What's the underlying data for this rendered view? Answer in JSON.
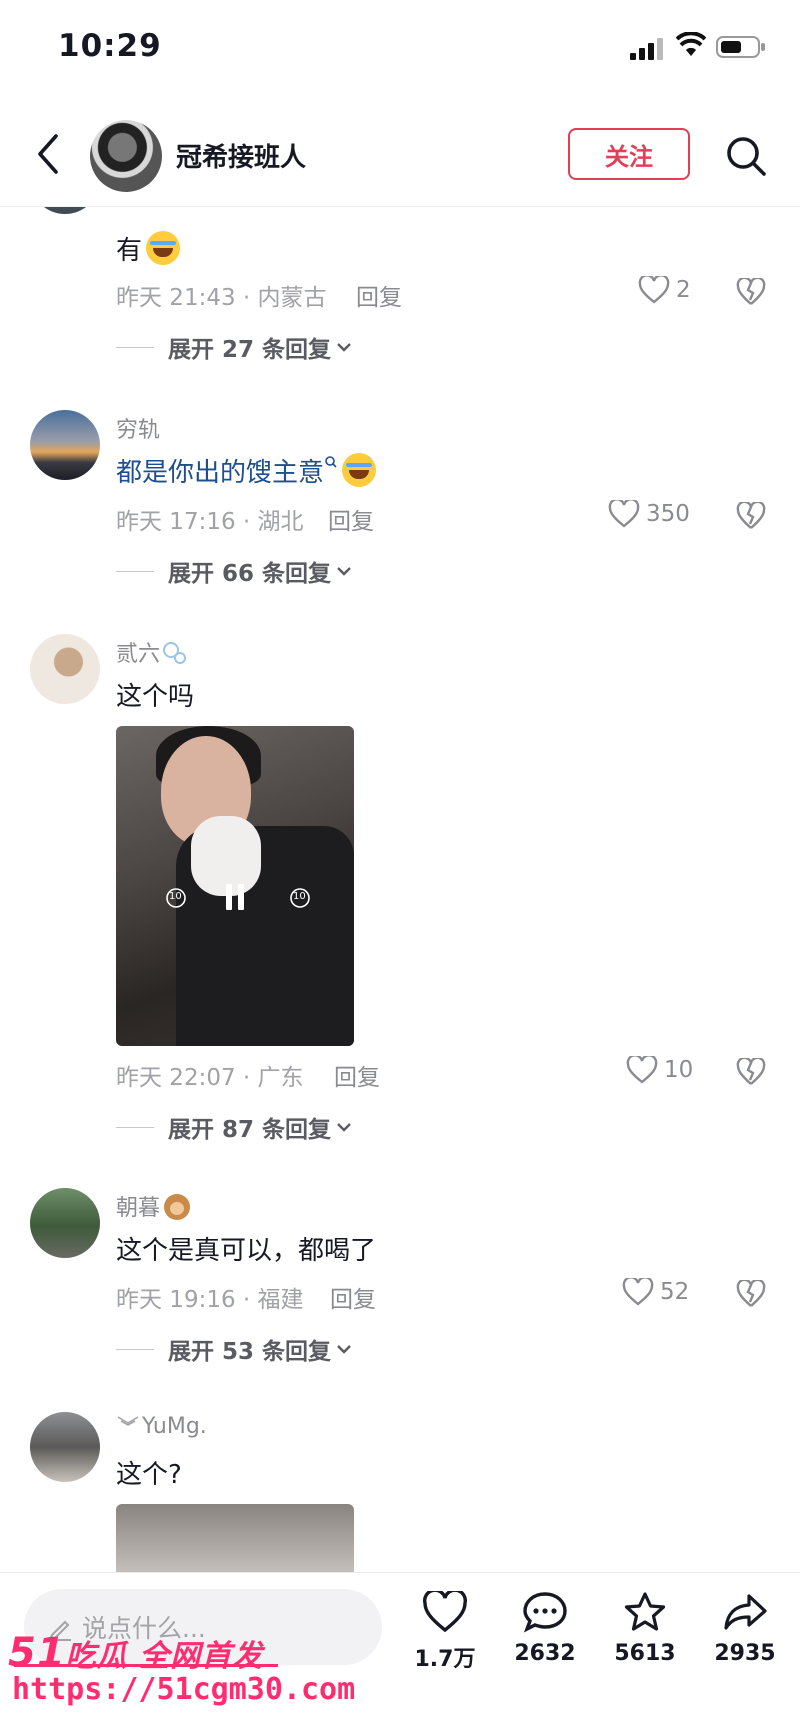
{
  "status_bar": {
    "time": "10:29"
  },
  "header": {
    "title": "冠希接班人",
    "follow_label": "关注"
  },
  "comments": [
    {
      "username": "",
      "text": "有",
      "meta": "昨天 21:43 · 内蒙古",
      "reply_label": "回复",
      "likes": "2",
      "expand": "展开 27 条回复"
    },
    {
      "username": "穷轨",
      "text": "都是你出的馊主意",
      "meta": "昨天 17:16 · 湖北",
      "reply_label": "回复",
      "likes": "350",
      "expand": "展开 66 条回复"
    },
    {
      "username": "贰六",
      "text": "这个吗",
      "meta": "昨天 22:07 · 广东",
      "reply_label": "回复",
      "likes": "10",
      "expand": "展开 87 条回复"
    },
    {
      "username": "朝暮",
      "text": "这个是真可以，都喝了",
      "meta": "昨天 19:16 · 福建",
      "reply_label": "回复",
      "likes": "52",
      "expand": "展开 53 条回复"
    },
    {
      "username": "YuMg.",
      "text": "这个?"
    }
  ],
  "video": {
    "skip_back": "10",
    "skip_forward": "10"
  },
  "bottom_bar": {
    "input_placeholder": "说点什么...",
    "likes": "1.7万",
    "comments": "2632",
    "favorites": "5613",
    "shares": "2935"
  },
  "watermark": {
    "line1_num": "51",
    "line1_text": "吃瓜 全网首发",
    "line2": "https://51cgm30.com"
  },
  "colors": {
    "accent": "#e23e57",
    "link_text": "#1f4e8f",
    "watermark": "#ff2d70"
  }
}
